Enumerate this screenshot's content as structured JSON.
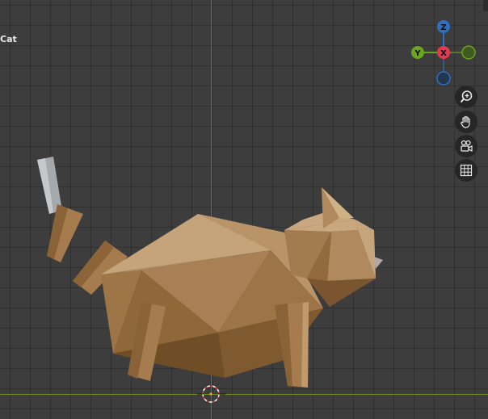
{
  "viewport": {
    "object_label": "Cat",
    "background_color": "#3d3d3d",
    "grid_color": "#333333"
  },
  "gizmo": {
    "z_label": "Z",
    "y_label": "Y",
    "x_label": "X",
    "z_color": "#2e6fc2",
    "y_color": "#6aa51e",
    "x_color": "#e33a4f"
  },
  "navigation": {
    "buttons": [
      {
        "name": "zoom",
        "icon": "zoom-in-icon"
      },
      {
        "name": "pan",
        "icon": "hand-icon"
      },
      {
        "name": "camera",
        "icon": "camera-icon"
      },
      {
        "name": "ortho",
        "icon": "grid-icon"
      }
    ]
  },
  "model": {
    "name": "Cat",
    "body_color": "#b08a5e",
    "tail_tip_color": "#a9adb0"
  }
}
